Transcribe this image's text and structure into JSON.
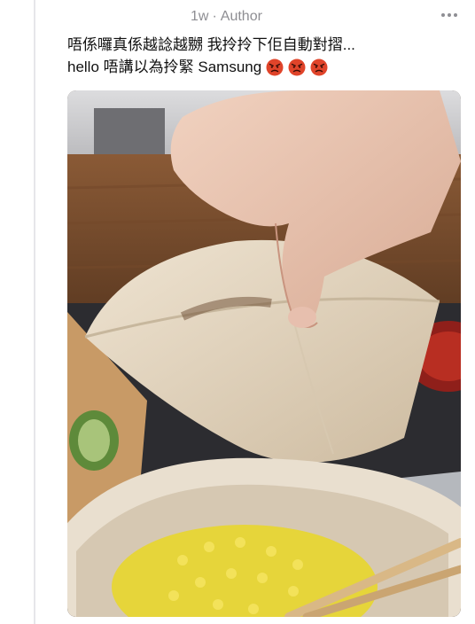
{
  "header": {
    "timestamp": "1w",
    "separator": "·",
    "role": "Author"
  },
  "icons": {
    "more": "more-horizontal-icon",
    "emoji": "angry-face-emoji"
  },
  "post": {
    "line1": "唔係囉真係越諗越嬲 我拎拎下佢自動對摺...",
    "line2": "hello 唔講以為拎緊 Samsung",
    "emoji_count": 3
  },
  "photo": {
    "subject": "hand-folding-paper-bowl"
  },
  "colors": {
    "meta_text": "#8e8e93",
    "body_text": "#111111",
    "thread_line": "#e6e6ea",
    "emoji": "#e0442a"
  }
}
